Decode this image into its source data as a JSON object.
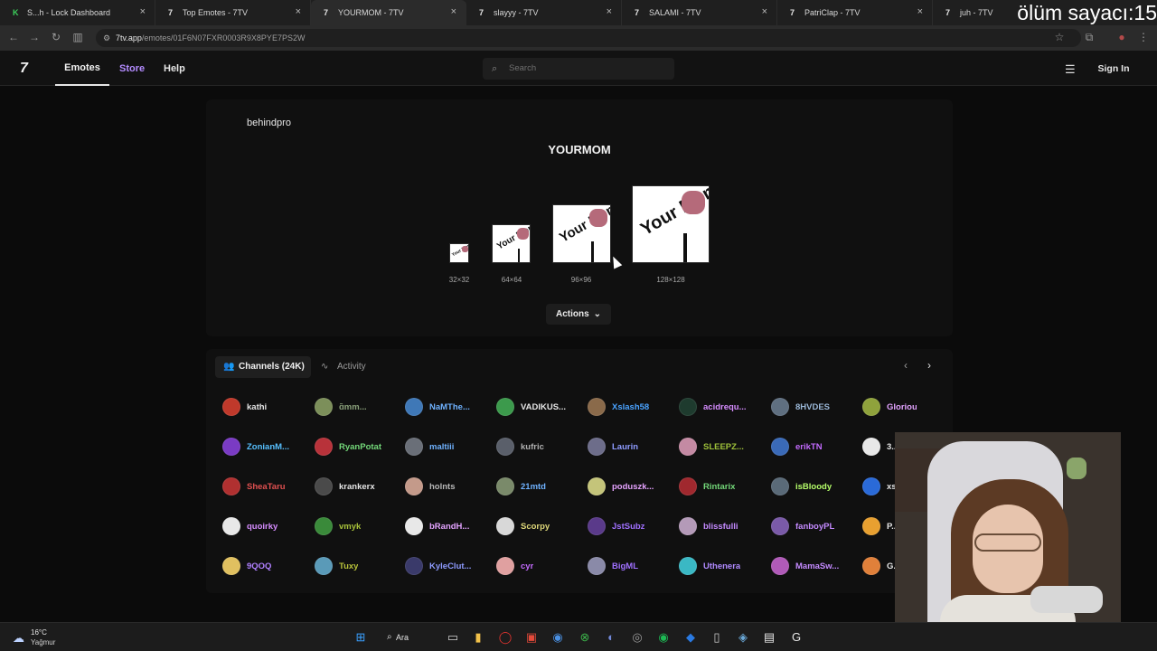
{
  "browser": {
    "tabs": [
      {
        "title": "S...h - Lock Dashboard",
        "favicon": "kick-icon",
        "active": false
      },
      {
        "title": "Top Emotes - 7TV",
        "favicon": "7tv-icon",
        "active": false
      },
      {
        "title": "YOURMOM - 7TV",
        "favicon": "7tv-icon",
        "active": true
      },
      {
        "title": "slayyy - 7TV",
        "favicon": "7tv-icon",
        "active": false
      },
      {
        "title": "SALAMI - 7TV",
        "favicon": "7tv-icon",
        "active": false
      },
      {
        "title": "PatriClap - 7TV",
        "favicon": "7tv-icon",
        "active": false
      },
      {
        "title": "juh - 7TV",
        "favicon": "7tv-icon",
        "active": false
      }
    ],
    "overlay_text": "ölüm sayacı:15",
    "url_domain": "7tv.app",
    "url_path": "/emotes/01F6N07FXR0003R9X8PYE7PS2W"
  },
  "site": {
    "logo": "7",
    "nav": {
      "emotes": "Emotes",
      "store": "Store",
      "help": "Help"
    },
    "search_placeholder": "Search",
    "signin": "Sign In"
  },
  "emote": {
    "owner": "behindpro",
    "name": "YOURMOM",
    "image_text": "Your Mom",
    "sizes": [
      "32×32",
      "64×64",
      "96×96",
      "128×128"
    ],
    "actions_label": "Actions"
  },
  "channels": {
    "tab_label": "Channels (24K)",
    "activity_label": "Activity",
    "rows": [
      [
        {
          "name": "kathi",
          "color": "#e6e6e6",
          "avatar": "#c0392b"
        },
        {
          "name": "ɑ̃mm...",
          "color": "#8aa07a",
          "avatar": "#7c8f5a"
        },
        {
          "name": "NaMThe...",
          "color": "#6fb2ff",
          "avatar": "#3f78b7"
        },
        {
          "name": "VADIKUS...",
          "color": "#e6e6e6",
          "avatar": "#3c9a4c"
        },
        {
          "name": "Xslash58",
          "color": "#4aa3ff",
          "avatar": "#8a6a4a"
        },
        {
          "name": "acidrequ...",
          "color": "#d68cff",
          "avatar": "#1e3b2e"
        },
        {
          "name": "8HVDES",
          "color": "#9bb8d8",
          "avatar": "#5f6f80"
        },
        {
          "name": "Glorious...",
          "color": "#e3a3ff",
          "avatar": "#8fa23c"
        }
      ],
      [
        {
          "name": "ZonianM...",
          "color": "#57c0ff",
          "avatar": "#7a3bc4"
        },
        {
          "name": "RyanPotat",
          "color": "#74d97a",
          "avatar": "#b8323a"
        },
        {
          "name": "maltiii",
          "color": "#6fb2ff",
          "avatar": "#6a6f78"
        },
        {
          "name": "kufric",
          "color": "#b0b0b0",
          "avatar": "#5a5f6a"
        },
        {
          "name": "Laurin",
          "color": "#8e9bff",
          "avatar": "#6d6d8a"
        },
        {
          "name": "SLEEPZ...",
          "color": "#9fc23a",
          "avatar": "#c48aa3"
        },
        {
          "name": "erikTN",
          "color": "#c46bff",
          "avatar": "#3a6ab8"
        },
        {
          "name": "3...",
          "color": "#e6e6e6",
          "avatar": "#e8e8e8"
        }
      ],
      [
        {
          "name": "SheaTaru",
          "color": "#e05050",
          "avatar": "#b03030"
        },
        {
          "name": "krankerx",
          "color": "#e6e6e6",
          "avatar": "#4a4a4a"
        },
        {
          "name": "holnts",
          "color": "#b8b8b8",
          "avatar": "#c49a8a"
        },
        {
          "name": "21mtd",
          "color": "#6fb2ff",
          "avatar": "#7a8a6a"
        },
        {
          "name": "poduszk...",
          "color": "#e6a3ff",
          "avatar": "#c4c47a"
        },
        {
          "name": "Rintarix",
          "color": "#74d97a",
          "avatar": "#a0282e"
        },
        {
          "name": "isBloody",
          "color": "#b6ff6a",
          "avatar": "#5a6a78"
        },
        {
          "name": "xs...",
          "color": "#e6e6e6",
          "avatar": "#2a6ad8"
        }
      ],
      [
        {
          "name": "quoirky",
          "color": "#d68cff",
          "avatar": "#e8e8e8"
        },
        {
          "name": "vmyk",
          "color": "#a8c23a",
          "avatar": "#3a8a3a"
        },
        {
          "name": "bRandH...",
          "color": "#e3a3ff",
          "avatar": "#e8e8e8"
        },
        {
          "name": "Scorpy",
          "color": "#e0d97a",
          "avatar": "#d8d8d8"
        },
        {
          "name": "JstSubz",
          "color": "#a070ff",
          "avatar": "#5a3a8a"
        },
        {
          "name": "blissfulli",
          "color": "#c48aff",
          "avatar": "#b49ab8"
        },
        {
          "name": "fanboyPL",
          "color": "#c48aff",
          "avatar": "#7a5aa8"
        },
        {
          "name": "P...",
          "color": "#e6e6e6",
          "avatar": "#e8a030"
        }
      ],
      [
        {
          "name": "9QOQ",
          "color": "#b080ff",
          "avatar": "#e0c060"
        },
        {
          "name": "Tuxy",
          "color": "#b8c23a",
          "avatar": "#5a9ab8"
        },
        {
          "name": "KyleClut...",
          "color": "#8e9bff",
          "avatar": "#3a3a6a"
        },
        {
          "name": "cyr",
          "color": "#c46bff",
          "avatar": "#e0a0a0"
        },
        {
          "name": "BigML",
          "color": "#a070ff",
          "avatar": "#8a8aa8"
        },
        {
          "name": "Uthenera",
          "color": "#b08aff",
          "avatar": "#3ab8c4"
        },
        {
          "name": "MamaSw...",
          "color": "#c48aff",
          "avatar": "#b05ab8"
        },
        {
          "name": "G...",
          "color": "#e6e6e6",
          "avatar": "#e0803a"
        }
      ]
    ]
  },
  "taskbar": {
    "temperature": "16°C",
    "condition": "Yağmur",
    "search_label": "Ara"
  }
}
